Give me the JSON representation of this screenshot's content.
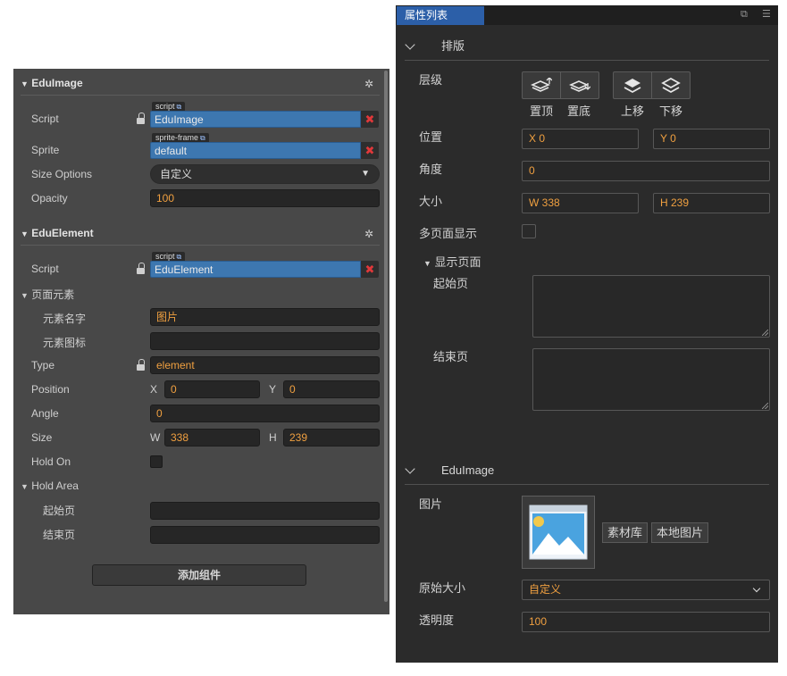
{
  "left_panel": {
    "edu_image": {
      "title": "EduImage",
      "script_label": "Script",
      "script_tag": "script",
      "script_value": "EduImage",
      "sprite_label": "Sprite",
      "sprite_tag": "sprite-frame",
      "sprite_value": "default",
      "size_options_label": "Size Options",
      "size_options_value": "自定义",
      "opacity_label": "Opacity",
      "opacity_value": "100"
    },
    "edu_element": {
      "title": "EduElement",
      "script_label": "Script",
      "script_tag": "script",
      "script_value": "EduElement",
      "page_element_label": "页面元素",
      "element_name_label": "元素名字",
      "element_name_value": "图片",
      "element_icon_label": "元素图标",
      "element_icon_value": "",
      "type_label": "Type",
      "type_value": "element",
      "position_label": "Position",
      "position_x_label": "X",
      "position_x": "0",
      "position_y_label": "Y",
      "position_y": "0",
      "angle_label": "Angle",
      "angle_value": "0",
      "size_label": "Size",
      "size_w_label": "W",
      "size_w": "338",
      "size_h_label": "H",
      "size_h": "239",
      "hold_on_label": "Hold On",
      "hold_area_label": "Hold Area",
      "start_page_label": "起始页",
      "end_page_label": "结束页"
    },
    "add_component_label": "添加组件"
  },
  "right_panel": {
    "tab_title": "属性列表",
    "layout_section": "排版",
    "layer_label": "层级",
    "layer_buttons": [
      "置顶",
      "置底",
      "上移",
      "下移"
    ],
    "position_label": "位置",
    "position_x": "X  0",
    "position_y": "Y  0",
    "angle_label": "角度",
    "angle_value": "0",
    "size_label": "大小",
    "size_w": "W  338",
    "size_h": "H  239",
    "multipage_label": "多页面显示",
    "display_pages_label": "显示页面",
    "start_page_label": "起始页",
    "end_page_label": "结束页",
    "edu_image_section": "EduImage",
    "image_label": "图片",
    "library_button": "素材库",
    "local_image_button": "本地图片",
    "original_size_label": "原始大小",
    "original_size_value": "自定义",
    "opacity_label": "透明度",
    "opacity_value": "100"
  },
  "colors": {
    "accent_blue": "#2c5fa8",
    "value_orange": "#f0a040",
    "clear_red": "#e0383a"
  }
}
